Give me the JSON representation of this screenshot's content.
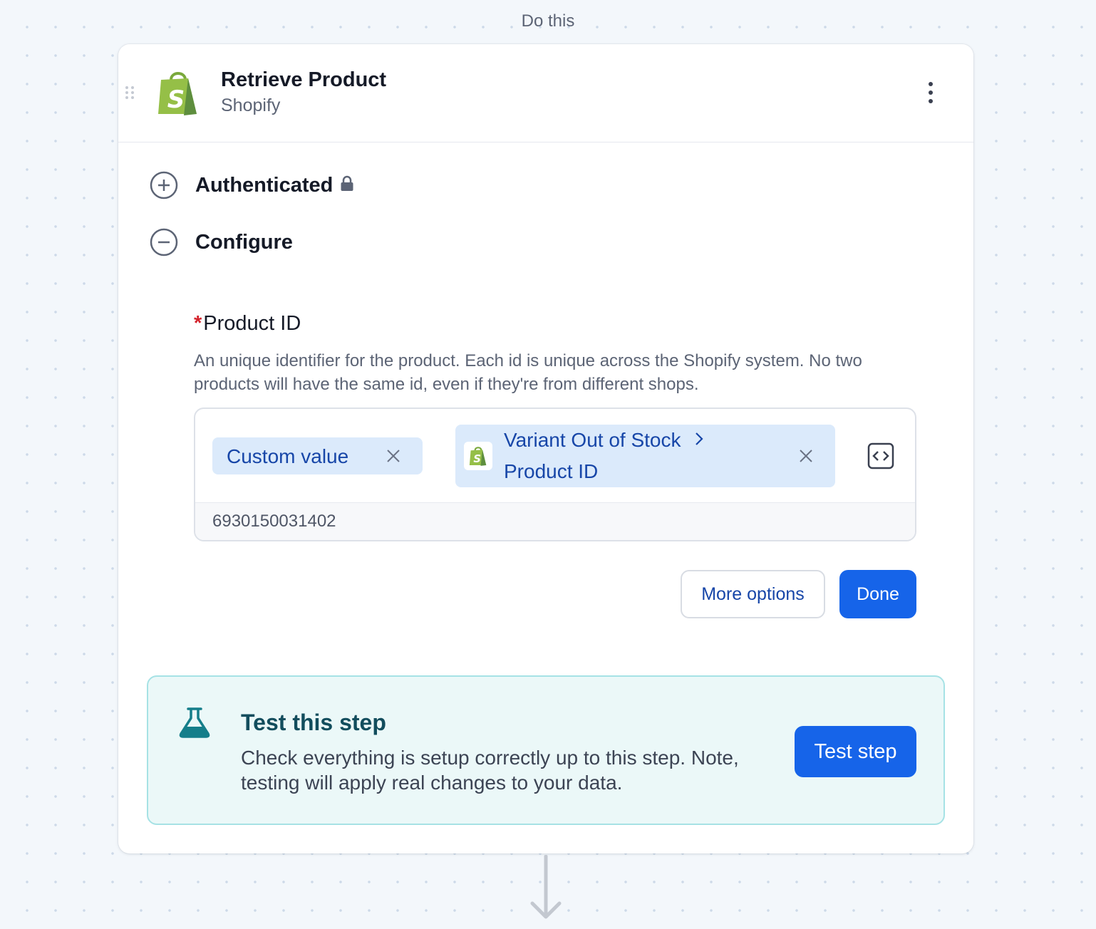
{
  "flow": {
    "label": "Do this"
  },
  "step": {
    "title": "Retrieve Product",
    "app": "Shopify",
    "app_icon": "shopify-bag-icon",
    "brand_color": "#95BF47"
  },
  "sections": [
    {
      "label": "Authenticated",
      "state": "collapsed",
      "locked": true
    },
    {
      "label": "Configure",
      "state": "expanded"
    }
  ],
  "field": {
    "required_mark": "*",
    "label": "Product ID",
    "description": "An unique identifier for the product. Each id is unique across the Shopify system. No two products will have the same id, even if they're from different shops.",
    "chips": {
      "custom": "Custom value",
      "source": "Variant Out of Stock",
      "source_field": "Product ID"
    },
    "value": "6930150031402"
  },
  "actions": {
    "more_options": "More options",
    "done": "Done"
  },
  "test": {
    "title": "Test this step",
    "description": "Check everything is setup correctly up to this step. Note, testing will apply real changes to your data.",
    "button": "Test step"
  },
  "colors": {
    "primary": "#1664E9",
    "chip_bg": "#DBEAFB",
    "chip_text": "#1746A8",
    "test_bg": "#EBF8F8",
    "test_border": "#A6E2E5",
    "test_title": "#124D5D",
    "required": "#D4232C"
  }
}
